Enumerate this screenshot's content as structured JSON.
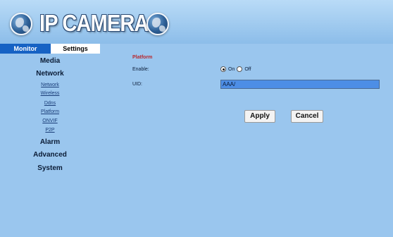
{
  "header": {
    "title": "IP CAMERA"
  },
  "tabs": [
    {
      "label": "Monitor"
    },
    {
      "label": "Settings"
    }
  ],
  "menu": {
    "media": "Media",
    "network": "Network",
    "network_items": [
      "Network",
      "Wireless",
      "Ddns",
      "Platform",
      "ONVIF",
      "P2P"
    ],
    "alarm": "Alarm",
    "advanced": "Advanced",
    "system": "System"
  },
  "form": {
    "section_title": "Platform",
    "enable_label": "Enable:",
    "enable_options": [
      "On",
      "Off"
    ],
    "enable_selected": "On",
    "uid_label": "UID:",
    "uid_value": "AAA/"
  },
  "buttons": {
    "apply": "Apply",
    "cancel": "Cancel"
  },
  "colors": {
    "background": "#9ac6ee",
    "tab_active": "#1662c4",
    "section_title": "#b8282e",
    "uid_input": "#4d8ee6"
  }
}
